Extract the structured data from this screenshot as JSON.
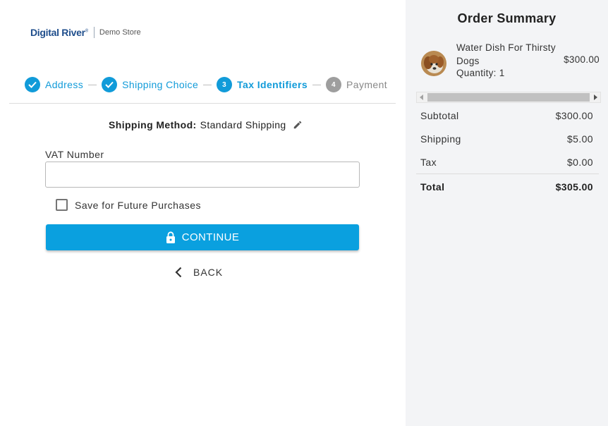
{
  "brand": {
    "name": "Digital River",
    "reg_mark": "®",
    "store": "Demo Store"
  },
  "stepper": {
    "steps": [
      {
        "label": "Address",
        "state": "done",
        "number": ""
      },
      {
        "label": "Shipping Choice",
        "state": "done",
        "number": ""
      },
      {
        "label": "Tax Identifiers",
        "state": "active",
        "number": "3"
      },
      {
        "label": "Payment",
        "state": "todo",
        "number": "4"
      }
    ]
  },
  "shipping": {
    "label": "Shipping Method:",
    "value": "Standard Shipping",
    "edit_icon": "pencil-icon"
  },
  "form": {
    "vat_label": "VAT Number",
    "vat_value": "",
    "vat_placeholder": "",
    "save_label": "Save for Future Purchases",
    "save_checked": false
  },
  "actions": {
    "continue_label": "CONTINUE",
    "continue_icon": "lock-icon",
    "back_label": "BACK",
    "back_icon": "chevron-left-icon"
  },
  "order_summary": {
    "title": "Order Summary",
    "item": {
      "name": "Water Dish For Thirsty Dogs",
      "quantity": "Quantity: 1",
      "price": "$300.00"
    },
    "rows": [
      {
        "label": "Subtotal",
        "value": "$300.00"
      },
      {
        "label": "Shipping",
        "value": "$5.00"
      },
      {
        "label": "Tax",
        "value": "$0.00"
      }
    ],
    "total": {
      "label": "Total",
      "value": "$305.00"
    }
  },
  "colors": {
    "accent": "#0aa0df",
    "step_done": "#119bd9",
    "step_todo": "#9e9e9e",
    "summary_bg": "#f3f4f6",
    "brand": "#1f4e8c"
  }
}
